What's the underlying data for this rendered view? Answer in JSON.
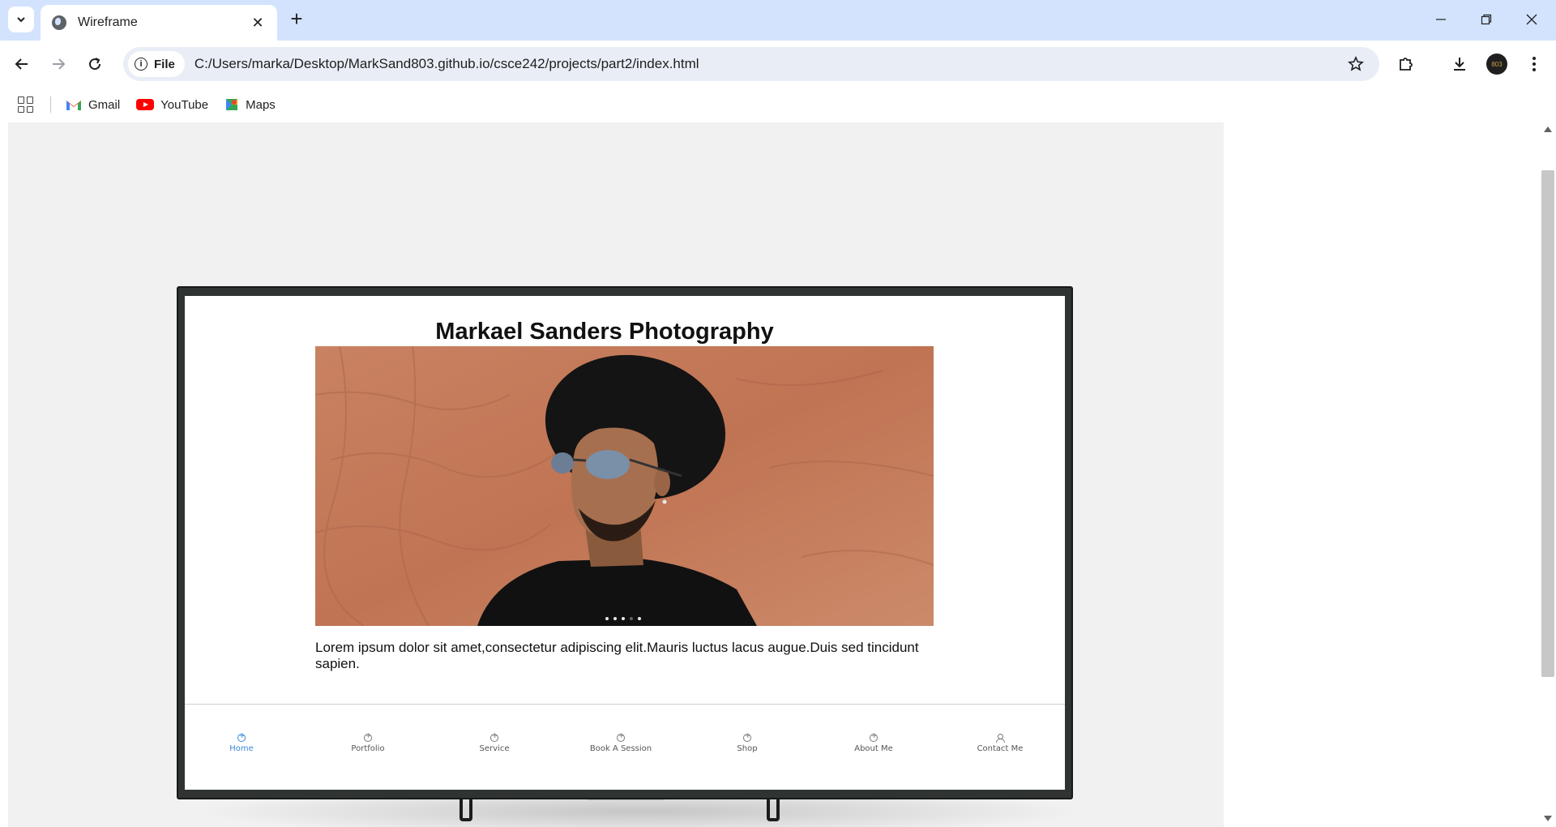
{
  "browser": {
    "tab_title": "Wireframe",
    "address_chip": "File",
    "url": "C:/Users/marka/Desktop/MarkSand803.github.io/csce242/projects/part2/index.html",
    "profile_initials": "803"
  },
  "bookmarks": [
    {
      "label": "Gmail",
      "icon": "gmail-icon"
    },
    {
      "label": "YouTube",
      "icon": "youtube-icon"
    },
    {
      "label": "Maps",
      "icon": "maps-icon"
    }
  ],
  "site": {
    "title": "Markael Sanders Photography",
    "hero_image": "portrait of man in black hat and sunglasses against terracotta wall",
    "slide_count": 5,
    "body": "Lorem ipsum dolor sit amet,consectetur adipiscing elit.Mauris luctus lacus augue.Duis sed tincidunt sapien.",
    "nav": [
      {
        "label": "Home",
        "active": true
      },
      {
        "label": "Portfolio",
        "active": false
      },
      {
        "label": "Service",
        "active": false
      },
      {
        "label": "Book A Session",
        "active": false
      },
      {
        "label": "Shop",
        "active": false
      },
      {
        "label": "About Me",
        "active": false
      },
      {
        "label": "Contact Me",
        "active": false
      }
    ]
  },
  "colors": {
    "tabstrip": "#d3e3fd",
    "omnibox": "#e9eef6",
    "canvas": "#f1f1f1",
    "nav_active": "#3a86d8",
    "hero_wall": "#c47858"
  }
}
